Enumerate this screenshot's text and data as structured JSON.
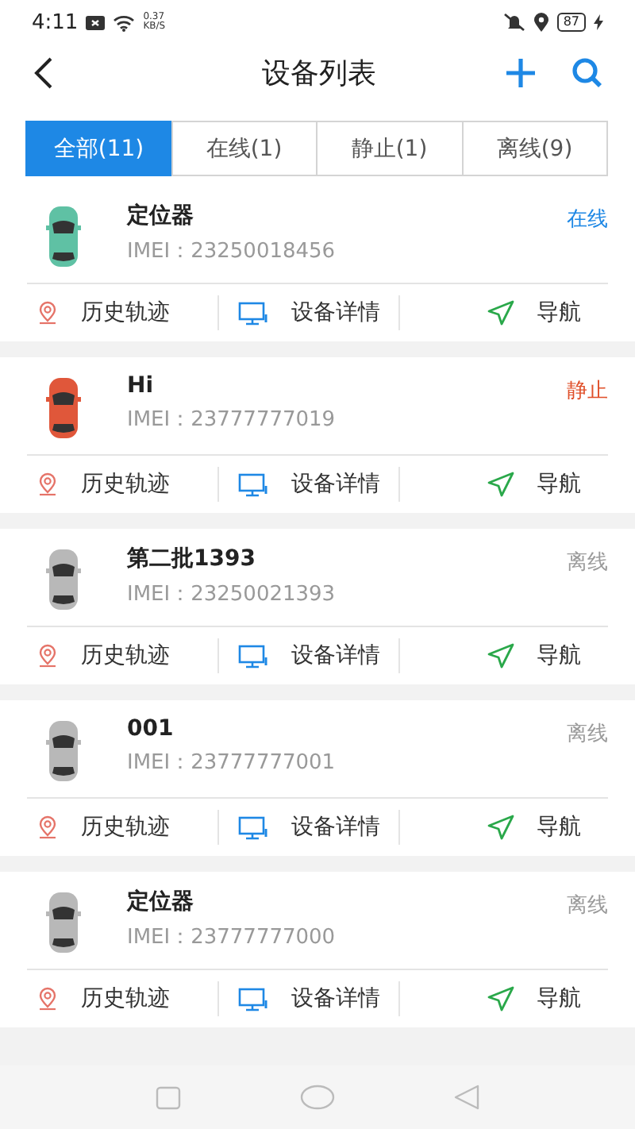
{
  "status_bar": {
    "time": "4:11",
    "speed": "0.37",
    "speed_unit": "KB/S",
    "battery": "87"
  },
  "header": {
    "title": "设备列表"
  },
  "tabs": [
    {
      "label": "全部(11)",
      "selected": true
    },
    {
      "label": "在线(1)",
      "selected": false
    },
    {
      "label": "静止(1)",
      "selected": false
    },
    {
      "label": "离线(9)",
      "selected": false
    }
  ],
  "devices": [
    {
      "name": "定位器",
      "imei": "IMEI：23250018456",
      "status": "在线",
      "kind": "online",
      "actions": [
        "历史轨迹",
        "设备详情",
        "导航"
      ]
    },
    {
      "name": "Hi",
      "imei": "IMEI：23777777019",
      "status": "静止",
      "kind": "static",
      "actions": [
        "历史轨迹",
        "设备详情",
        "导航"
      ]
    },
    {
      "name": "第二批1393",
      "imei": "IMEI：23250021393",
      "status": "离线",
      "kind": "offline",
      "actions": [
        "历史轨迹",
        "设备详情",
        "导航"
      ]
    },
    {
      "name": "001",
      "imei": "IMEI：23777777001",
      "status": "离线",
      "kind": "offline",
      "actions": [
        "历史轨迹",
        "设备详情",
        "导航"
      ]
    },
    {
      "name": "定位器",
      "imei": "IMEI：23777777000",
      "status": "离线",
      "kind": "offline",
      "actions": [
        "历史轨迹",
        "设备详情",
        "导航"
      ]
    }
  ]
}
